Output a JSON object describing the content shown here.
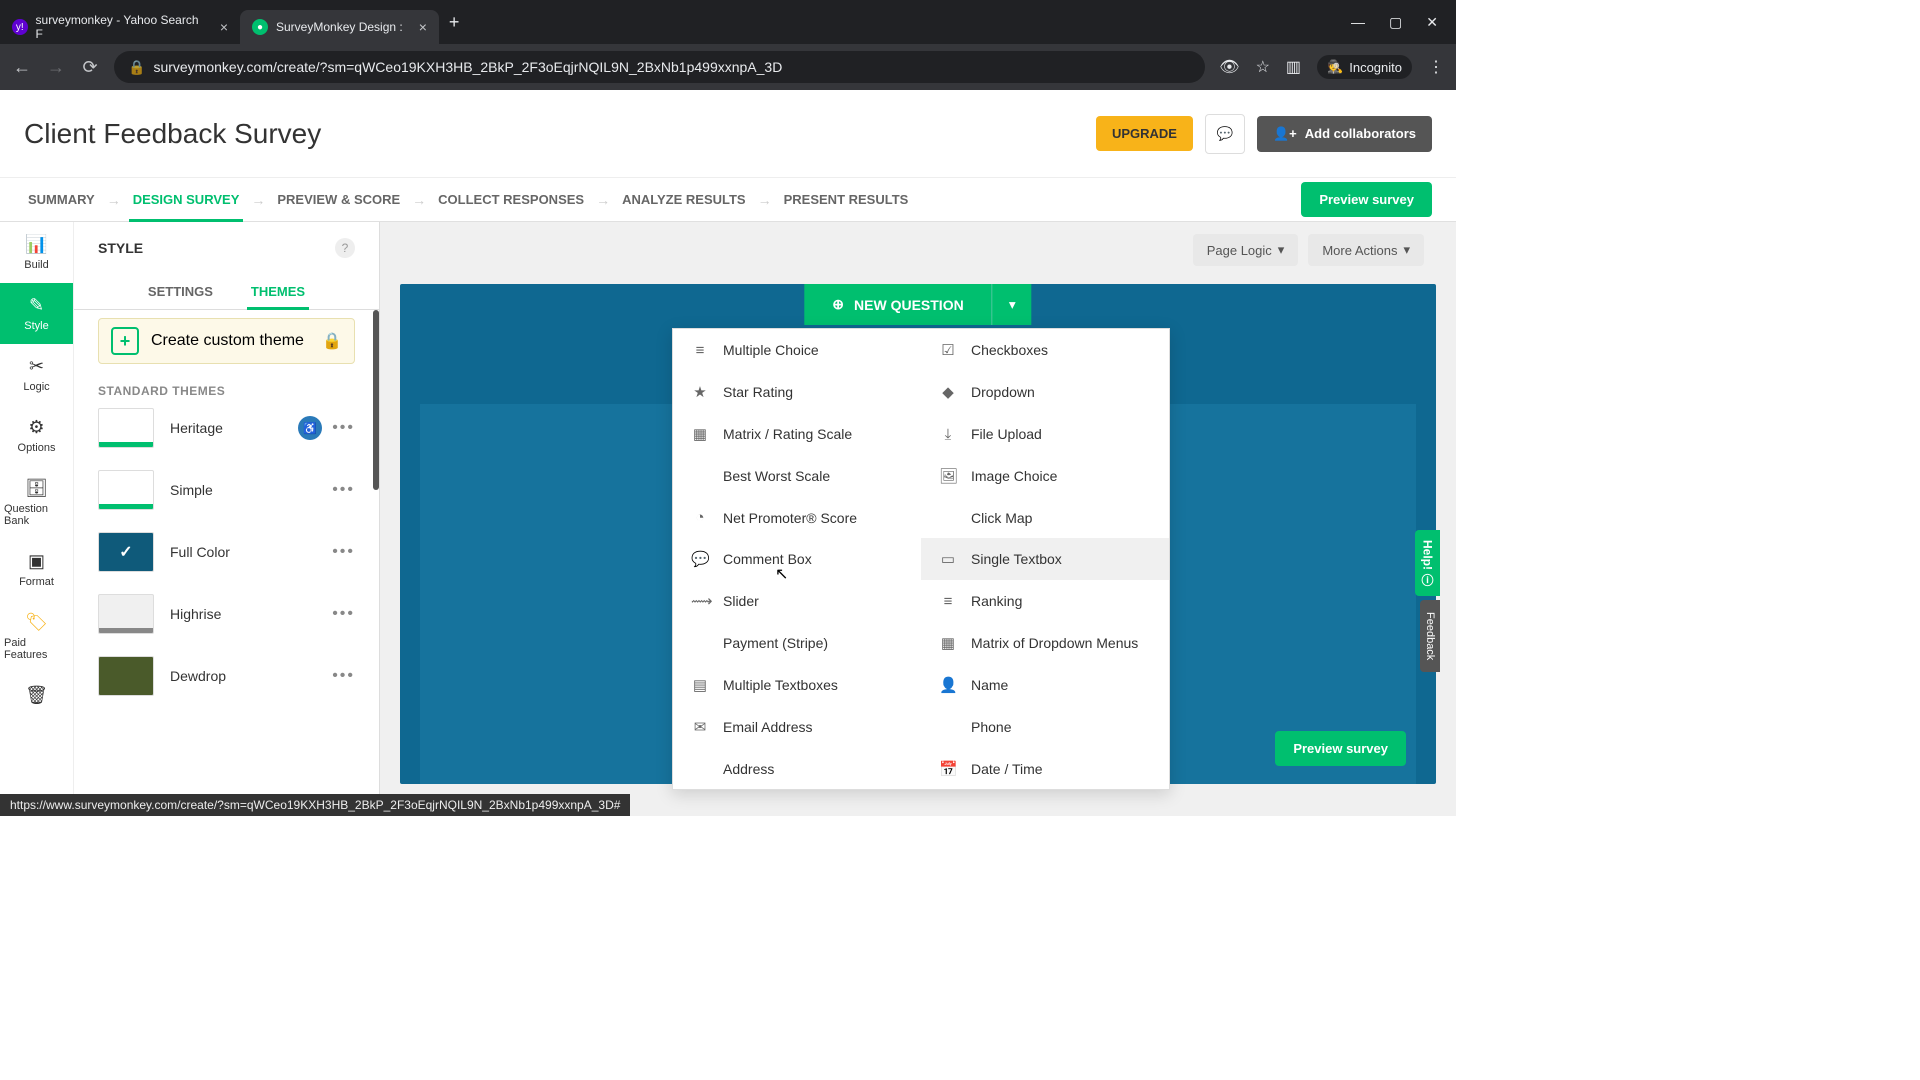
{
  "browser": {
    "tabs": [
      {
        "title": "surveymonkey - Yahoo Search F",
        "favicon_bg": "#5f01d1"
      },
      {
        "title": "SurveyMonkey Design :",
        "favicon_bg": "#00bf6f",
        "active": true
      }
    ],
    "url": "surveymonkey.com/create/?sm=qWCeo19KXH3HB_2BkP_2F3oEqjrNQIL9N_2BxNb1p499xxnpA_3D",
    "incognito_label": "Incognito"
  },
  "header": {
    "title": "Client Feedback Survey",
    "upgrade": "UPGRADE",
    "collaborators": "Add collaborators"
  },
  "nav": {
    "items": [
      "SUMMARY",
      "DESIGN SURVEY",
      "PREVIEW & SCORE",
      "COLLECT RESPONSES",
      "ANALYZE RESULTS",
      "PRESENT RESULTS"
    ],
    "active_index": 1,
    "preview": "Preview survey"
  },
  "rail": {
    "items": [
      "Build",
      "Style",
      "Logic",
      "Options",
      "Question Bank",
      "Format",
      "Paid Features"
    ],
    "active_index": 1
  },
  "style_panel": {
    "title": "STYLE",
    "sub_tabs": [
      "SETTINGS",
      "THEMES"
    ],
    "active_sub": 1,
    "create_custom": "Create custom theme",
    "section": "STANDARD THEMES",
    "themes": [
      "Heritage",
      "Simple",
      "Full Color",
      "Highrise",
      "Dewdrop"
    ]
  },
  "canvas": {
    "page_logic": "Page Logic",
    "more_actions": "More Actions",
    "new_question": "NEW QUESTION",
    "float_preview": "Preview survey",
    "help": "Help!",
    "feedback": "Feedback"
  },
  "question_types": {
    "left": [
      "Multiple Choice",
      "Star Rating",
      "Matrix / Rating Scale",
      "Best Worst Scale",
      "Net Promoter® Score",
      "Comment Box",
      "Slider",
      "Payment (Stripe)",
      "Multiple Textboxes",
      "Email Address",
      "Address"
    ],
    "right": [
      "Checkboxes",
      "Dropdown",
      "File Upload",
      "Image Choice",
      "Click Map",
      "Single Textbox",
      "Ranking",
      "Matrix of Dropdown Menus",
      "Name",
      "Phone",
      "Date / Time"
    ],
    "left_icons": [
      "≡",
      "★",
      "▦",
      "",
      "◔",
      "💬",
      "⟿",
      "",
      "▤",
      "✉",
      ""
    ],
    "right_icons": [
      "☑",
      "◆",
      "⤓",
      "🖼",
      "",
      "▭",
      "≡",
      "▦",
      "👤",
      "",
      "📅"
    ],
    "highlighted_right_index": 5
  },
  "status_url": "https://www.surveymonkey.com/create/?sm=qWCeo19KXH3HB_2BkP_2F3oEqjrNQIL9N_2BxNb1p499xxnpA_3D#"
}
